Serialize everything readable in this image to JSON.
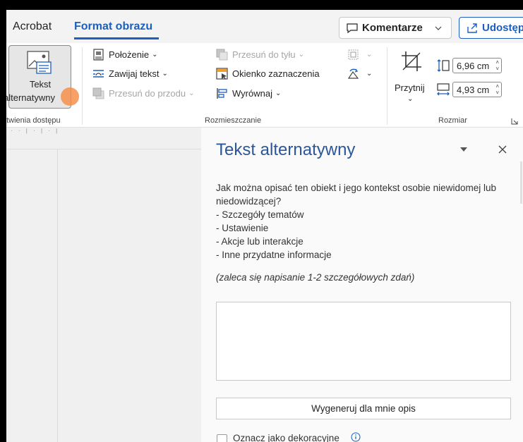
{
  "tabs": {
    "acrobat": "Acrobat",
    "format": "Format obrazu"
  },
  "header": {
    "comment_label": "Komentarze",
    "share_label": "Udostęp"
  },
  "ribbon": {
    "alt_text_line1": "Tekst",
    "alt_text_line2": "alternatywny",
    "accessibility_group": "atwienia dostępu",
    "position": "Położenie",
    "wrap_text": "Zawijaj tekst",
    "bring_forward": "Przesuń do przodu",
    "send_backward": "Przesuń do tyłu",
    "selection_pane": "Okienko zaznaczenia",
    "align": "Wyrównaj",
    "arrange_group": "Rozmieszczanie",
    "crop": "Przytnij",
    "height_value": "6,96 cm",
    "width_value": "4,93 cm",
    "size_group": "Rozmiar"
  },
  "pane": {
    "title": "Tekst alternatywny",
    "question": "Jak można opisać ten obiekt i jego kontekst osobie niewidomej lub niedowidzącej?",
    "bullets": [
      "- Szczegóły tematów",
      "- Ustawienie",
      "- Akcje lub interakcje",
      "- Inne przydatne informacje"
    ],
    "hint": "(zaleca się napisanie 1-2 szczegółowych zdań)",
    "textarea_value": "",
    "generate_label": "Wygeneruj dla mnie opis",
    "decorative_label": "Oznacz jako dekoracyjne",
    "decorative_checked": false
  },
  "colors": {
    "accent": "#1b5fbf",
    "pane_title": "#2b579a",
    "cursor": "#f58c46"
  },
  "icons": [
    "comment-icon",
    "share-icon",
    "alt-text-icon",
    "position-icon",
    "wrap-text-icon",
    "bring-forward-icon",
    "send-backward-icon",
    "selection-pane-icon",
    "align-icon",
    "group-icon",
    "rotate-icon",
    "crop-icon",
    "height-icon",
    "width-icon",
    "dialog-launcher-icon",
    "pane-menu-icon",
    "close-icon",
    "info-icon"
  ]
}
